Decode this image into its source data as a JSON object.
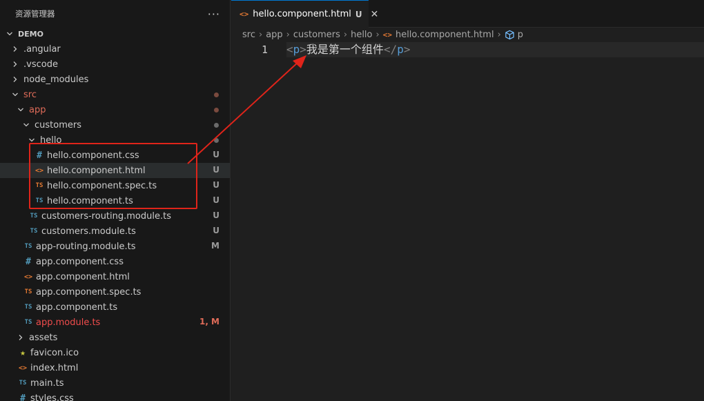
{
  "sidebar": {
    "title": "资源管理器",
    "more": "···",
    "items": [
      {
        "label": "DEMO",
        "depth": 0,
        "type": "folder-open",
        "style": "bold"
      },
      {
        "label": ".angular",
        "depth": 1,
        "type": "folder-closed"
      },
      {
        "label": ".vscode",
        "depth": 1,
        "type": "folder-closed"
      },
      {
        "label": "node_modules",
        "depth": 1,
        "type": "folder-closed"
      },
      {
        "label": "src",
        "depth": 1,
        "type": "folder-open",
        "style": "git-red",
        "dot": "mod"
      },
      {
        "label": "app",
        "depth": 2,
        "type": "folder-open",
        "style": "git-red",
        "dot": "mod"
      },
      {
        "label": "customers",
        "depth": 3,
        "type": "folder-open",
        "dot": "grey"
      },
      {
        "label": "hello",
        "depth": 4,
        "type": "folder-open",
        "dot": "grey"
      },
      {
        "label": "hello.component.css",
        "depth": 5,
        "type": "css",
        "badge": "U"
      },
      {
        "label": "hello.component.html",
        "depth": 5,
        "type": "html",
        "badge": "U",
        "selected": true
      },
      {
        "label": "hello.component.spec.ts",
        "depth": 5,
        "type": "ts-o",
        "badge": "U"
      },
      {
        "label": "hello.component.ts",
        "depth": 5,
        "type": "ts-b",
        "badge": "U"
      },
      {
        "label": "customers-routing.module.ts",
        "depth": 4,
        "type": "ts-b",
        "badge": "U"
      },
      {
        "label": "customers.module.ts",
        "depth": 4,
        "type": "ts-b",
        "badge": "U"
      },
      {
        "label": "app-routing.module.ts",
        "depth": 3,
        "type": "ts-b",
        "badge": "M"
      },
      {
        "label": "app.component.css",
        "depth": 3,
        "type": "css"
      },
      {
        "label": "app.component.html",
        "depth": 3,
        "type": "html"
      },
      {
        "label": "app.component.spec.ts",
        "depth": 3,
        "type": "ts-o"
      },
      {
        "label": "app.component.ts",
        "depth": 3,
        "type": "ts-b"
      },
      {
        "label": "app.module.ts",
        "depth": 3,
        "type": "ts-b",
        "style": "err",
        "badge": "1, M"
      },
      {
        "label": "assets",
        "depth": 2,
        "type": "folder-closed"
      },
      {
        "label": "favicon.ico",
        "depth": 2,
        "type": "star"
      },
      {
        "label": "index.html",
        "depth": 2,
        "type": "html"
      },
      {
        "label": "main.ts",
        "depth": 2,
        "type": "ts-b"
      },
      {
        "label": "styles.css",
        "depth": 2,
        "type": "css"
      }
    ]
  },
  "icons": {
    "css": "#",
    "html": "<>",
    "ts": "TS",
    "star": "★"
  },
  "tab": {
    "label": "hello.component.html",
    "badge": "U",
    "close": "✕"
  },
  "breadcrumb": {
    "segments": [
      "src",
      "app",
      "customers",
      "hello",
      "hello.component.html",
      "p"
    ]
  },
  "editor": {
    "line_number": "1",
    "code": {
      "open_lt": "<",
      "open_tag": "p",
      "open_gt": ">",
      "text": "我是第一个组件",
      "close_lt": "</",
      "close_tag": "p",
      "close_gt": ">"
    }
  },
  "colors": {
    "highlight_box": "#e0241a",
    "arrow": "#e0241a",
    "accent": "#0078d4"
  }
}
